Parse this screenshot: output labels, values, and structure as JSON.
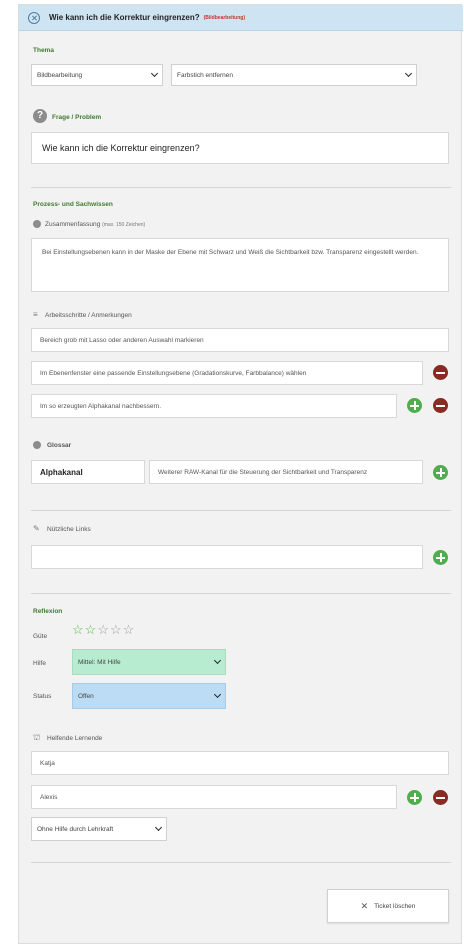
{
  "header": {
    "title": "Wie kann ich die Korrektur eingrenzen?",
    "tag": "(Bildbearbeitung)"
  },
  "thema": {
    "label": "Thema",
    "category": "Bildbearbeitung",
    "subcategory": "Farbstich entfernen"
  },
  "frage": {
    "label": "Frage / Problem",
    "value": "Wie kann ich die Korrektur eingrenzen?"
  },
  "prozess": {
    "label": "Prozess- und Sachwissen",
    "summary_label": "Zusammenfassung",
    "summary_hint": "(max. 150 Zeichen)",
    "summary_text": "Bei Einstellungsebenen kann in der Maske der Ebene mit Schwarz und Weiß die Sichtbarkeit bzw. Transparenz eingestellt werden.",
    "steps_label": "Arbeitsschritte / Anmerkungen",
    "steps": [
      "Bereich grob mit Lasso oder anderen Auswahl markieren",
      "Im Ebenenfenster eine passende Einstellungsebene (Gradationskurve, Farbbalance) wählen",
      "Im so erzeugten Alphakanal nachbessern."
    ]
  },
  "glossar": {
    "label": "Glossar",
    "term": "Alphakanal",
    "definition": "Weiterer RAW-Kanal für die Steuerung der Sichtbarkeit und Transparenz"
  },
  "links": {
    "label": "Nützliche Links",
    "value": ""
  },
  "reflexion": {
    "label": "Reflexion",
    "guete_label": "Güte",
    "rating": 2,
    "max_rating": 5,
    "hilfe_label": "Hilfe",
    "hilfe_value": "Mittel: Mit Hilfe",
    "status_label": "Status",
    "status_value": "Offen",
    "lernende_label": "Helfende Lernende",
    "lernende": [
      "Katja",
      "Alexis"
    ],
    "hilfe_select": "Ohne Hilfe durch Lehrkraft"
  },
  "actions": {
    "close_label": "Ticket löschen"
  },
  "colors": {
    "header_bg": "#cfe4f3",
    "accent_green": "#4cae4c",
    "remove_red": "#8a2a22",
    "hilfe_bg": "#b8ecd0",
    "status_bg": "#bcdcf5"
  }
}
